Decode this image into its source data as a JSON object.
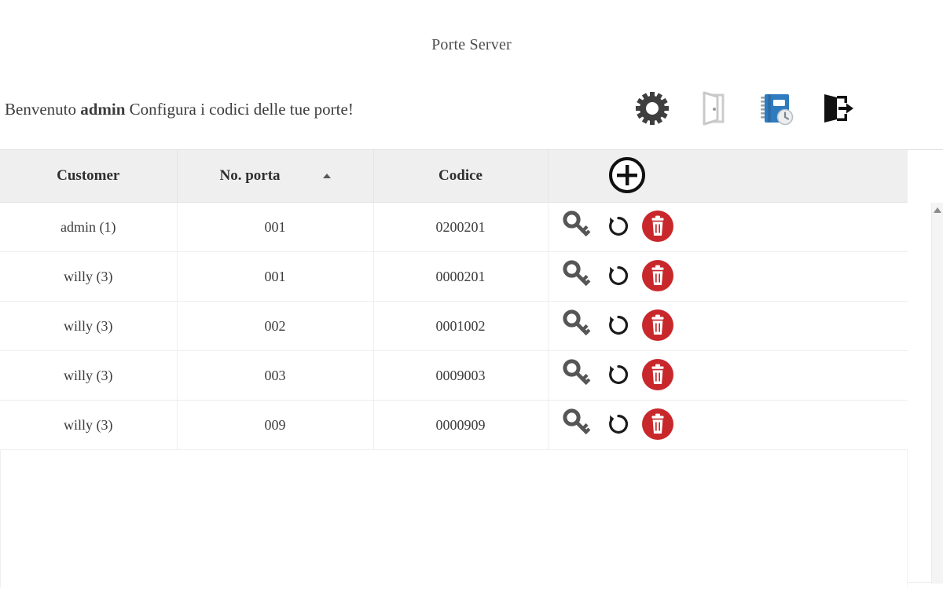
{
  "header": {
    "title": "Porte Server"
  },
  "welcome": {
    "prefix": "Benvenuto ",
    "user": "admin",
    "suffix": " Configura i codici delle tue porte!"
  },
  "toolbar": {
    "items": [
      {
        "name": "settings-icon",
        "label": "Impostazioni"
      },
      {
        "name": "door-icon",
        "label": "Porte"
      },
      {
        "name": "logbook-icon",
        "label": "Storico"
      },
      {
        "name": "logout-icon",
        "label": "Esci"
      }
    ]
  },
  "table": {
    "columns": [
      {
        "key": "customer",
        "label": "Customer",
        "sortable": true,
        "sorted": false
      },
      {
        "key": "porta",
        "label": "No. porta",
        "sortable": true,
        "sorted": true,
        "sort_dir": "asc"
      },
      {
        "key": "codice",
        "label": "Codice",
        "sortable": true,
        "sorted": false
      },
      {
        "key": "actions",
        "label": "",
        "sortable": false,
        "sorted": false
      }
    ],
    "add_button_label": "+",
    "rows": [
      {
        "customer": "admin (1)",
        "porta": "001",
        "codice": "0200201"
      },
      {
        "customer": "willy (3)",
        "porta": "001",
        "codice": "0000201"
      },
      {
        "customer": "willy (3)",
        "porta": "002",
        "codice": "0001002"
      },
      {
        "customer": "willy (3)",
        "porta": "003",
        "codice": "0009003"
      },
      {
        "customer": "willy (3)",
        "porta": "009",
        "codice": "0000909"
      }
    ],
    "row_actions": [
      {
        "name": "key-icon",
        "label": "Chiave"
      },
      {
        "name": "reset-icon",
        "label": "Rigenera"
      },
      {
        "name": "delete-icon",
        "label": "Elimina"
      }
    ]
  },
  "colors": {
    "header_bg": "#efefef",
    "delete_red": "#c8282b",
    "logbook_blue": "#2f7bbf",
    "gear_gray": "#3f3f3f",
    "key_gray": "#565656",
    "page_bg": "#ffffff"
  }
}
